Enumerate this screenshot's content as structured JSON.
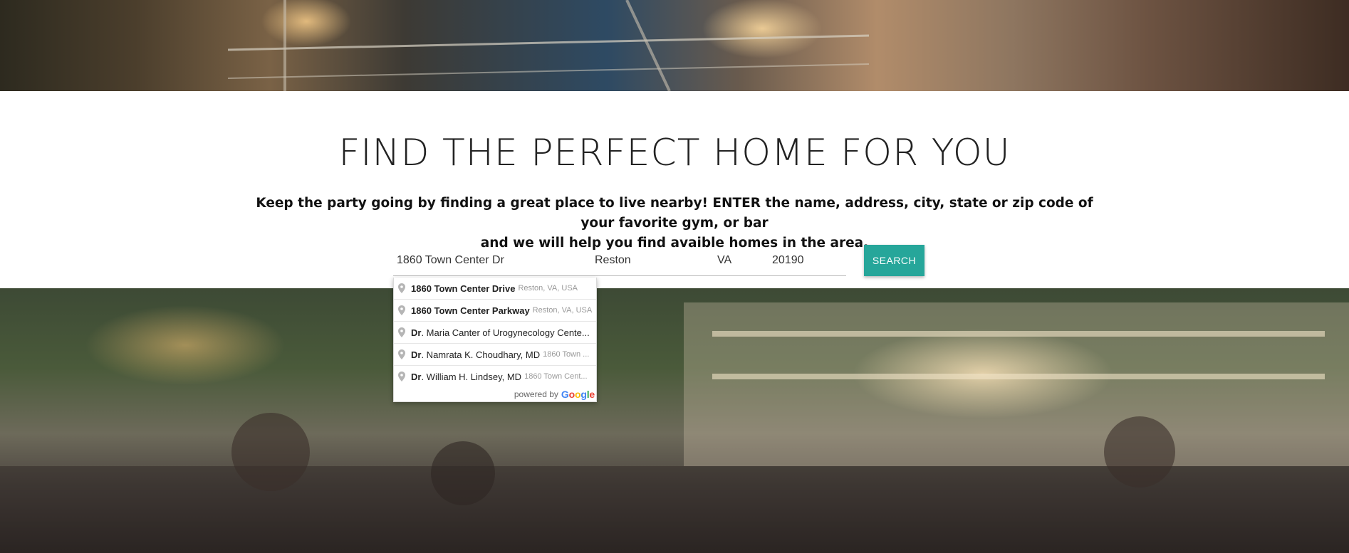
{
  "page": {
    "title": "FIND THE PERFECT HOME FOR YOU",
    "subtitle_line1": "Keep the party going by finding a great place to live nearby! ENTER the name, address, city, state or zip code of your favorite gym, or bar",
    "subtitle_line2": "and we will help you find avaible homes in the area."
  },
  "search": {
    "address_value": "1860 Town Center Dr",
    "city_value": "Reston",
    "state_value": "VA",
    "zip_value": "20190",
    "button_label": "SEARCH",
    "button_color": "#26a69a"
  },
  "autocomplete": {
    "items": [
      {
        "main_bold": "1860 Town Center",
        "main_rest": " Drive",
        "main_rest_bold": true,
        "secondary": "Reston, VA, USA"
      },
      {
        "main_bold": "1860 Town Center",
        "main_rest": " Parkway",
        "main_rest_bold": true,
        "secondary": "Reston, VA, USA"
      },
      {
        "main_bold": "Dr",
        "main_rest": ". Maria Canter of Urogynecology Cente...",
        "main_rest_bold": false,
        "secondary": ""
      },
      {
        "main_bold": "Dr",
        "main_rest": ". Namrata K. Choudhary, MD",
        "main_rest_bold": false,
        "secondary": "1860 Town ..."
      },
      {
        "main_bold": "Dr",
        "main_rest": ". William H. Lindsey, MD",
        "main_rest_bold": false,
        "secondary": "1860 Town Cent..."
      }
    ],
    "footer_text": "powered by",
    "footer_brand": "Google",
    "icon": "map-pin-icon"
  }
}
